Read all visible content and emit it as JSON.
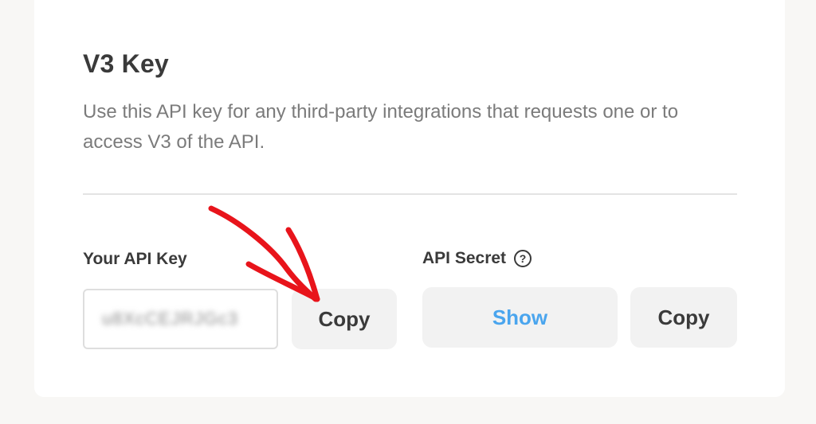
{
  "section": {
    "title": "V3 Key",
    "description": "Use this API key for any third-party integrations that requests one or to access V3 of the API."
  },
  "api_key": {
    "label": "Your API Key",
    "value": "u8XcCEJRJGc3",
    "copy_label": "Copy"
  },
  "api_secret": {
    "label": "API Secret",
    "help_icon": "question-circle-icon",
    "show_label": "Show",
    "copy_label": "Copy"
  },
  "colors": {
    "accent": "#4aa5ee",
    "annotation_arrow": "#e8141b"
  }
}
